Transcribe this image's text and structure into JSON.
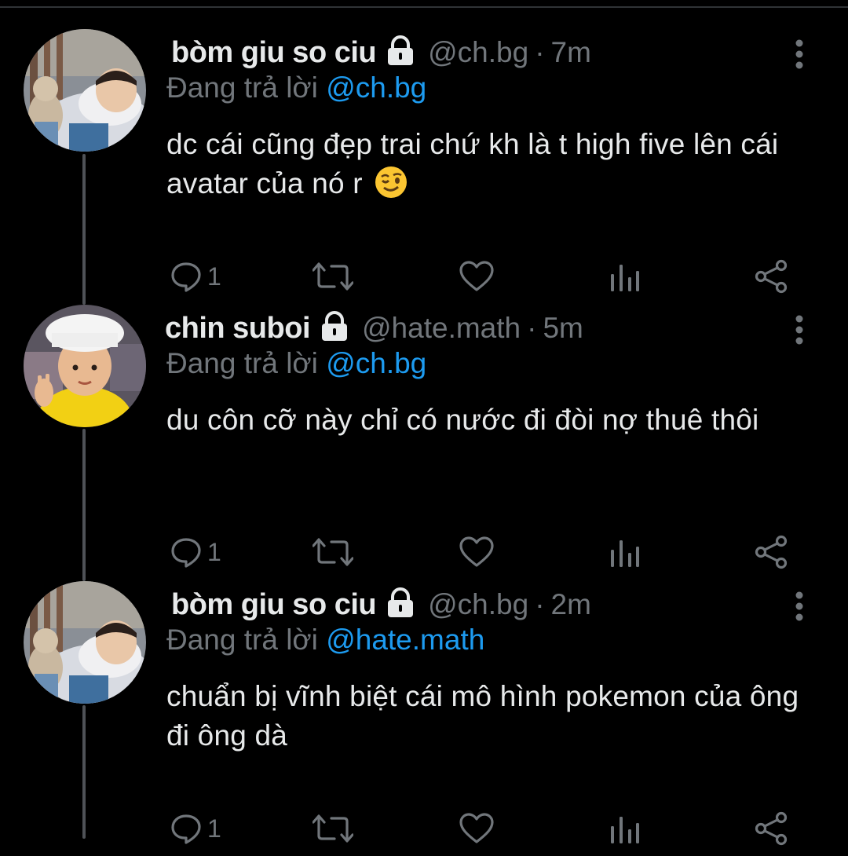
{
  "tweets": [
    {
      "display_name": "bòm giu so ciu",
      "handle": "@ch.bg",
      "separator": "·",
      "time": "7m",
      "reply_label": "Đang trả lời",
      "reply_to": "@ch.bg",
      "text": "dc cái cũng đẹp trai chứ kh là t high five lên cái avatar của nó r",
      "emoji": "winking-face",
      "reply_count": "1",
      "avatar": "sleeping-child-avatar"
    },
    {
      "display_name": "chin suboi",
      "handle": "@hate.math",
      "separator": "·",
      "time": "5m",
      "reply_label": "Đang trả lời",
      "reply_to": "@ch.bg",
      "text": "du côn cỡ này chỉ có nước đi đòi nợ thuê thôi",
      "emoji": "",
      "reply_count": "1",
      "avatar": "child-chef-hat-avatar"
    },
    {
      "display_name": "bòm giu so ciu",
      "handle": "@ch.bg",
      "separator": "·",
      "time": "2m",
      "reply_label": "Đang trả lời",
      "reply_to": "@hate.math",
      "text": "chuẩn bị vĩnh biệt cái mô hình pokemon của ông đi ông dà",
      "emoji": "",
      "reply_count": "1",
      "avatar": "sleeping-child-avatar"
    }
  ],
  "colors": {
    "background": "#000000",
    "primary_text": "#e7e9ea",
    "secondary_text": "#71767b",
    "link": "#1d9bf0",
    "thread_line": "#4f5257"
  },
  "icons": [
    "protected-lock-icon",
    "more-options-icon",
    "reply-icon",
    "retweet-icon",
    "like-icon",
    "analytics-icon",
    "share-icon"
  ]
}
